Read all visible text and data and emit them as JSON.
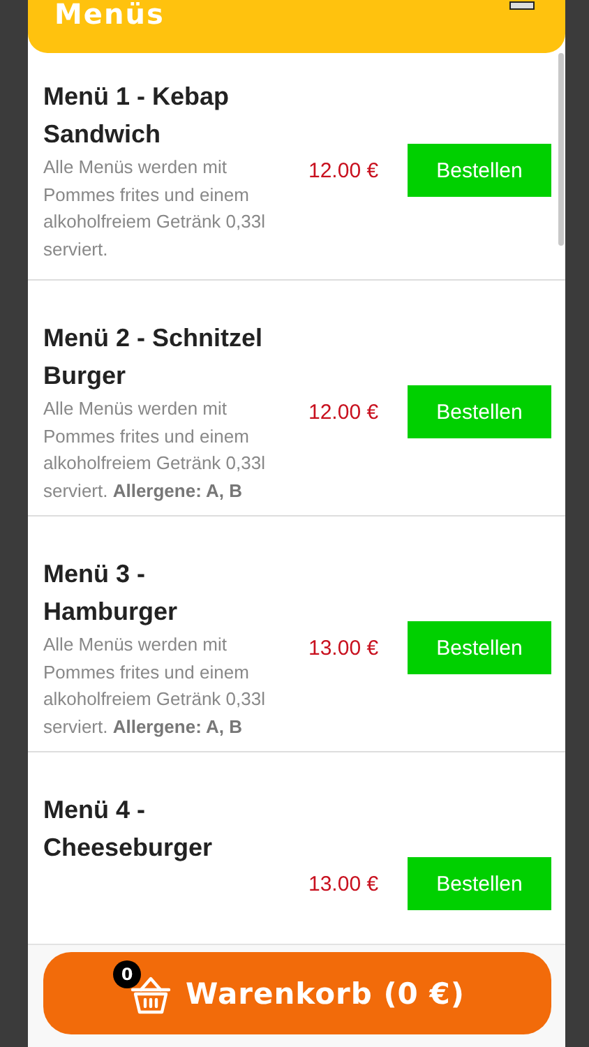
{
  "header": {
    "title": "Menüs"
  },
  "menus": [
    {
      "title": "Menü 1 - Kebap Sandwich",
      "description": "Alle Menüs werden mit Pommes frites und einem alkoholfreiem Getränk 0,33l serviert.",
      "price": "12.00 €",
      "button": "Bestellen"
    },
    {
      "title": "Menü 2 - Schnitzel Burger",
      "description": "Alle Menüs werden mit Pommes frites und einem alkoholfreiem Getränk 0,33l serviert. **Allergene: A, B**",
      "price": "12.00 €",
      "button": "Bestellen"
    },
    {
      "title": "Menü 3 - Hamburger",
      "description": "Alle Menüs werden mit Pommes frites und einem alkoholfreiem Getränk 0,33l serviert. **Allergene: A, B**",
      "price": "13.00 €",
      "button": "Bestellen"
    },
    {
      "title": "Menü 4 - Cheeseburger",
      "price": "13.00 €",
      "button": "Bestellen"
    }
  ],
  "cart": {
    "count": "0",
    "label": "Warenkorb (0 €)"
  }
}
